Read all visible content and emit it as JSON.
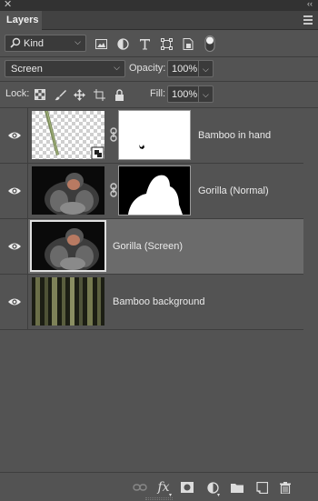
{
  "panel": {
    "close_glyph": "✕",
    "collapse_glyph": "‹‹",
    "tab_label": "Layers"
  },
  "filter": {
    "kind_label": "Kind",
    "icons": [
      "image-filter-icon",
      "adjustment-filter-icon",
      "type-filter-icon",
      "shape-filter-icon",
      "smart-object-filter-icon",
      "filter-toggle-icon"
    ]
  },
  "blend": {
    "mode": "Screen",
    "opacity_label": "Opacity:",
    "opacity_value": "100%"
  },
  "lock": {
    "label": "Lock:",
    "fill_label": "Fill:",
    "fill_value": "100%"
  },
  "layers": [
    {
      "name": "Bamboo in hand",
      "visible": true,
      "selected": false,
      "has_mask": true
    },
    {
      "name": "Gorilla (Normal)",
      "visible": true,
      "selected": false,
      "has_mask": true
    },
    {
      "name": "Gorilla (Screen)",
      "visible": true,
      "selected": true,
      "has_mask": false
    },
    {
      "name": "Bamboo background",
      "visible": true,
      "selected": false,
      "has_mask": false
    }
  ],
  "footer": {
    "fx_label": "fx",
    "icons": [
      "link-layers-icon",
      "fx-icon",
      "add-mask-icon",
      "adjustment-layer-icon",
      "new-group-icon",
      "new-layer-icon",
      "trash-icon"
    ]
  },
  "colors": {
    "panel_bg": "#535353",
    "selected_row": "#6b6b6b",
    "field_bg": "#3a3a3a"
  }
}
